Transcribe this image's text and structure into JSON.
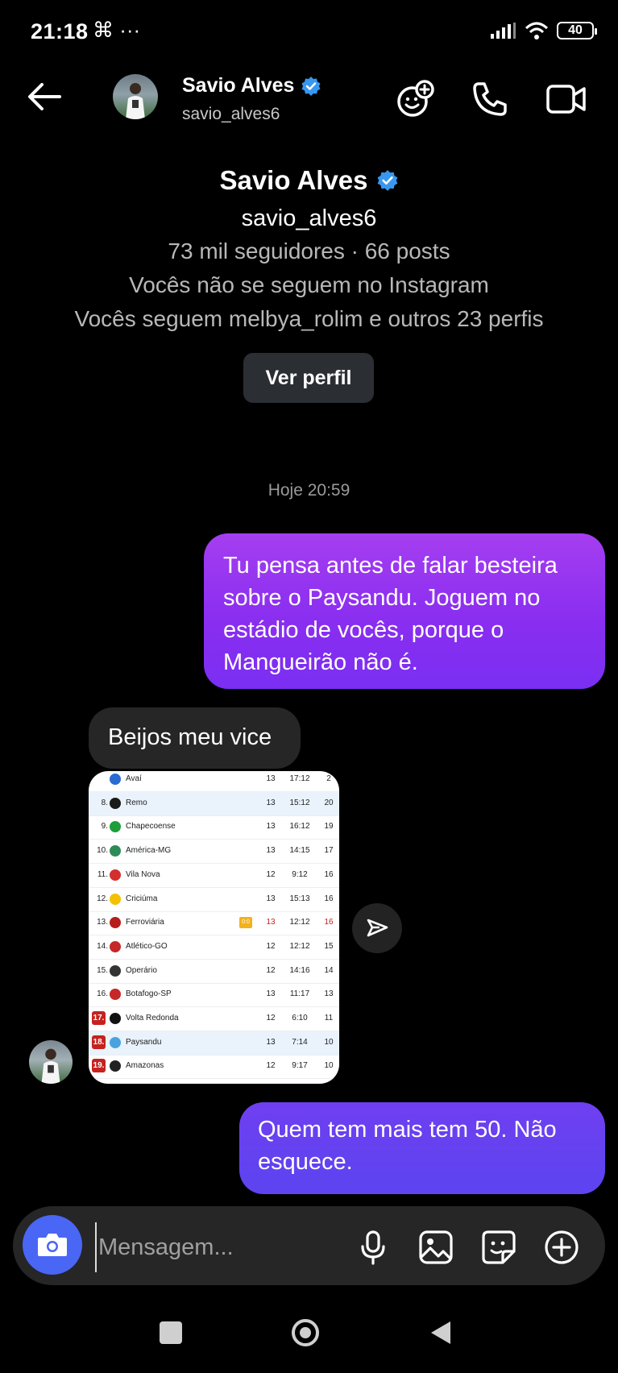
{
  "status": {
    "time": "21:18",
    "extra": "⌘ ···",
    "battery": "40"
  },
  "header": {
    "name": "Savio Alves",
    "handle": "savio_alves6"
  },
  "profile": {
    "name": "Savio Alves",
    "handle": "savio_alves6",
    "stats": "73 mil seguidores · 66 posts",
    "follow_status": "Vocês não se seguem no Instagram",
    "mutual": "Vocês seguem melbya_rolim e outros 23 perfis",
    "view_button": "Ver perfil"
  },
  "thread": {
    "timestamp": "Hoje 20:59",
    "messages": [
      {
        "from": "me",
        "text": "Tu pensa antes de falar besteira sobre o Paysandu. Joguem no estádio de vocês, porque o Mangueirão não é."
      },
      {
        "from": "them",
        "text": "Beijos meu vice"
      },
      {
        "from": "me",
        "text": "Quem tem mais tem 50. Não esquece."
      }
    ]
  },
  "standings": [
    {
      "pos": "",
      "team": "Avaí",
      "played": "13",
      "goals": "17:12",
      "pts": "2",
      "crest": "#2a6bd1"
    },
    {
      "pos": "8.",
      "team": "Remo",
      "played": "13",
      "goals": "15:12",
      "pts": "20",
      "crest": "#1a1a1a",
      "highlight": true
    },
    {
      "pos": "9.",
      "team": "Chapecoense",
      "played": "13",
      "goals": "16:12",
      "pts": "19",
      "crest": "#1f9d3a"
    },
    {
      "pos": "10.",
      "team": "América-MG",
      "played": "13",
      "goals": "14:15",
      "pts": "17",
      "crest": "#2e8b57"
    },
    {
      "pos": "11.",
      "team": "Vila Nova",
      "played": "12",
      "goals": "9:12",
      "pts": "16",
      "crest": "#d32f2f"
    },
    {
      "pos": "12.",
      "team": "Criciúma",
      "played": "13",
      "goals": "15:13",
      "pts": "16",
      "crest": "#f2c200"
    },
    {
      "pos": "13.",
      "team": "Ferroviária",
      "played": "13",
      "goals": "12:12",
      "pts": "16",
      "crest": "#b71c1c",
      "tag": "0:0",
      "red": true
    },
    {
      "pos": "14.",
      "team": "Atlético-GO",
      "played": "12",
      "goals": "12:12",
      "pts": "15",
      "crest": "#c62828"
    },
    {
      "pos": "15.",
      "team": "Operário",
      "played": "12",
      "goals": "14:16",
      "pts": "14",
      "crest": "#333333"
    },
    {
      "pos": "16.",
      "team": "Botafogo-SP",
      "played": "13",
      "goals": "11:17",
      "pts": "13",
      "crest": "#c62828"
    },
    {
      "pos": "17.",
      "team": "Volta Redonda",
      "played": "12",
      "goals": "6:10",
      "pts": "11",
      "crest": "#111111",
      "zone": true
    },
    {
      "pos": "18.",
      "team": "Paysandu",
      "played": "13",
      "goals": "7:14",
      "pts": "10",
      "crest": "#4aa3df",
      "zone": true,
      "highlight": true
    },
    {
      "pos": "19.",
      "team": "Amazonas",
      "played": "12",
      "goals": "9:17",
      "pts": "10",
      "crest": "#222222",
      "zone": true
    }
  ],
  "composer": {
    "placeholder": "Mensagem..."
  },
  "colors": {
    "accent": "#4a66f5",
    "bubble_me_top": "#a53ef0",
    "bubble_me_bottom": "#6f3ff0",
    "bubble_them": "#262626",
    "verified": "#3897f0"
  }
}
